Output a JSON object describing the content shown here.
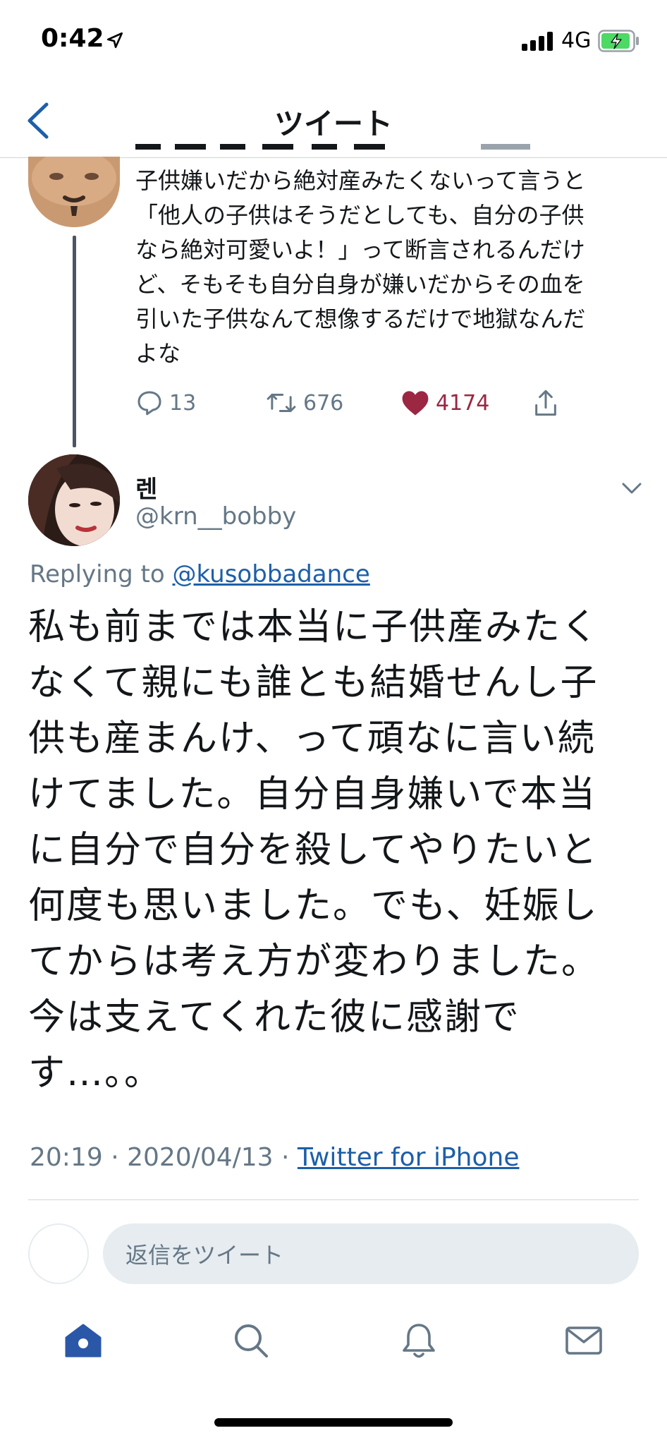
{
  "status_bar": {
    "time": "0:42",
    "network": "4G"
  },
  "nav": {
    "title": "ツイート"
  },
  "parent_tweet": {
    "text": "子供嫌いだから絶対産みたくないって言うと\n「他人の子供はそうだとしても、自分の子供\nなら絶対可愛いよ！」って断言されるんだけ\nど、そもそも自分自身が嫌いだからその血を\n引いた子供なんて想像するだけで地獄なんだ\nよな",
    "replies": "13",
    "retweets": "676",
    "likes": "4174"
  },
  "main_tweet": {
    "name": "렌",
    "handle": "@krn__bobby",
    "replying_label": "Replying to",
    "replying_handle": "@kusobbadance",
    "text": "私も前までは本当に子供産みたく\nなくて親にも誰とも結婚せんし子\n供も産まんけ、って頑なに言い続\nけてました。自分自身嫌いで本当\nに自分で自分を殺してやりたいと\n何度も思いました。でも、妊娠し\nてからは考え方が変わりました。\n今は支えてくれた彼に感謝で\nす…。。",
    "timestamp": "20:19 · 2020/04/13 · ",
    "source": "Twitter for iPhone"
  },
  "compose": {
    "placeholder": "返信をツイート"
  },
  "tabs": [
    "home-icon",
    "search-icon",
    "bell-icon",
    "mail-icon"
  ],
  "colors": {
    "accent": "#1d5fa8",
    "like": "#9b2743",
    "muted": "#657786",
    "battery": "#4cd964"
  }
}
